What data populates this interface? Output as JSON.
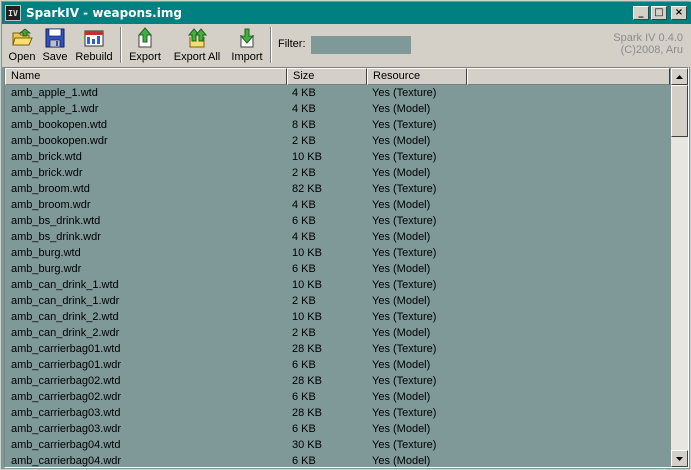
{
  "window": {
    "title": "SparkIV - weapons.img",
    "app_icon_text": "IV",
    "minimize_glyph": "_",
    "maximize_glyph": "□",
    "close_glyph": "×"
  },
  "toolbar": {
    "open_label": "Open",
    "save_label": "Save",
    "rebuild_label": "Rebuild",
    "export_label": "Export",
    "export_all_label": "Export All",
    "import_label": "Import",
    "filter_label": "Filter:",
    "filter_value": "",
    "version_line1": "Spark IV 0.4.0",
    "version_line2": "(C)2008, Aru"
  },
  "list": {
    "columns": [
      "Name",
      "Size",
      "Resource"
    ],
    "rows": [
      [
        "amb_apple_1.wtd",
        "4 KB",
        "Yes (Texture)"
      ],
      [
        "amb_apple_1.wdr",
        "4 KB",
        "Yes (Model)"
      ],
      [
        "amb_bookopen.wtd",
        "8 KB",
        "Yes (Texture)"
      ],
      [
        "amb_bookopen.wdr",
        "2 KB",
        "Yes (Model)"
      ],
      [
        "amb_brick.wtd",
        "10 KB",
        "Yes (Texture)"
      ],
      [
        "amb_brick.wdr",
        "2 KB",
        "Yes (Model)"
      ],
      [
        "amb_broom.wtd",
        "82 KB",
        "Yes (Texture)"
      ],
      [
        "amb_broom.wdr",
        "4 KB",
        "Yes (Model)"
      ],
      [
        "amb_bs_drink.wtd",
        "6 KB",
        "Yes (Texture)"
      ],
      [
        "amb_bs_drink.wdr",
        "4 KB",
        "Yes (Model)"
      ],
      [
        "amb_burg.wtd",
        "10 KB",
        "Yes (Texture)"
      ],
      [
        "amb_burg.wdr",
        "6 KB",
        "Yes (Model)"
      ],
      [
        "amb_can_drink_1.wtd",
        "10 KB",
        "Yes (Texture)"
      ],
      [
        "amb_can_drink_1.wdr",
        "2 KB",
        "Yes (Model)"
      ],
      [
        "amb_can_drink_2.wtd",
        "10 KB",
        "Yes (Texture)"
      ],
      [
        "amb_can_drink_2.wdr",
        "2 KB",
        "Yes (Model)"
      ],
      [
        "amb_carrierbag01.wtd",
        "28 KB",
        "Yes (Texture)"
      ],
      [
        "amb_carrierbag01.wdr",
        "6 KB",
        "Yes (Model)"
      ],
      [
        "amb_carrierbag02.wtd",
        "28 KB",
        "Yes (Texture)"
      ],
      [
        "amb_carrierbag02.wdr",
        "6 KB",
        "Yes (Model)"
      ],
      [
        "amb_carrierbag03.wtd",
        "28 KB",
        "Yes (Texture)"
      ],
      [
        "amb_carrierbag03.wdr",
        "6 KB",
        "Yes (Model)"
      ],
      [
        "amb_carrierbag04.wtd",
        "30 KB",
        "Yes (Texture)"
      ],
      [
        "amb_carrierbag04.wdr",
        "6 KB",
        "Yes (Model)"
      ]
    ]
  },
  "icons": {
    "open": "folder-open-icon",
    "save": "floppy-disk-icon",
    "rebuild": "rebuild-icon",
    "export": "export-arrow-icon",
    "export_all": "export-all-icon",
    "import": "import-arrow-icon"
  },
  "colors": {
    "titlebar": "#008080",
    "list_background": "#7f9898",
    "chrome": "#d4d0c8"
  }
}
